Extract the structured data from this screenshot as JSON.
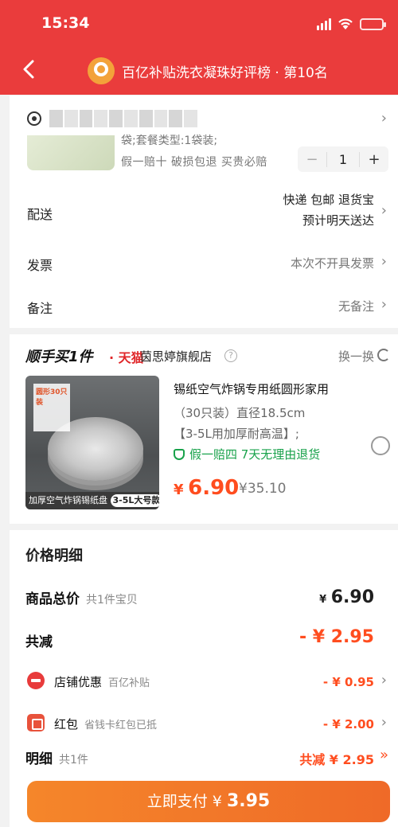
{
  "status": {
    "time": "15:34"
  },
  "header": {
    "rank_text": "百亿补贴洗衣凝珠好评榜 · 第10名"
  },
  "order": {
    "spec": "袋;套餐类型:1袋装;",
    "promises": "假一赔十  破损包退  买贵必赔",
    "quantity": "1",
    "delivery_label": "配送",
    "delivery_line1": "快递 包邮 退货宝",
    "delivery_line2": "预计明天送达",
    "invoice_label": "发票",
    "invoice_value": "本次不开具发票",
    "note_label": "备注",
    "note_value": "无备注"
  },
  "addon": {
    "title": "顺手买1件",
    "tmall": "· 天猫",
    "store": "茵思婷旗舰店",
    "swap": "换一换",
    "image_tag_top": "圆形30只装",
    "image_caption": "加厚空气炸锅锡纸盘",
    "image_size": "3-5L大号款",
    "product_title": "锡纸空气炸锅专用纸圆形家用",
    "product_sub1": "（30只装）直径18.5cm",
    "product_sub2": "【3-5L用加厚耐高温】;",
    "guarantee": "假一赔四  7天无理由退货",
    "price_currency": "¥",
    "price_value": "6.90",
    "price_old": "¥35.10"
  },
  "price_detail": {
    "title": "价格明细",
    "total_label": "商品总价",
    "total_sub": "共1件宝贝",
    "total_value_currency": "¥",
    "total_value": "6.90",
    "discount_label": "共减",
    "discount_value": "- ¥ 2.95",
    "store_label": "店铺优惠",
    "store_sub": "百亿补贴",
    "store_value": "- ¥ 0.95",
    "redpacket_label": "红包",
    "redpacket_sub": "省钱卡红包已抵",
    "redpacket_value": "- ¥ 2.00",
    "detail_label": "明细",
    "detail_sub": "共1件",
    "detail_value": "共减 ¥ 2.95",
    "pay_label": "立即支付 ¥ ",
    "pay_amount": "3.95"
  },
  "colors": {
    "header_red": "#ea3c3c",
    "price_orange": "#ff4d1f",
    "guarantee_green": "#19a24b",
    "pay_button": "#f5862a"
  }
}
